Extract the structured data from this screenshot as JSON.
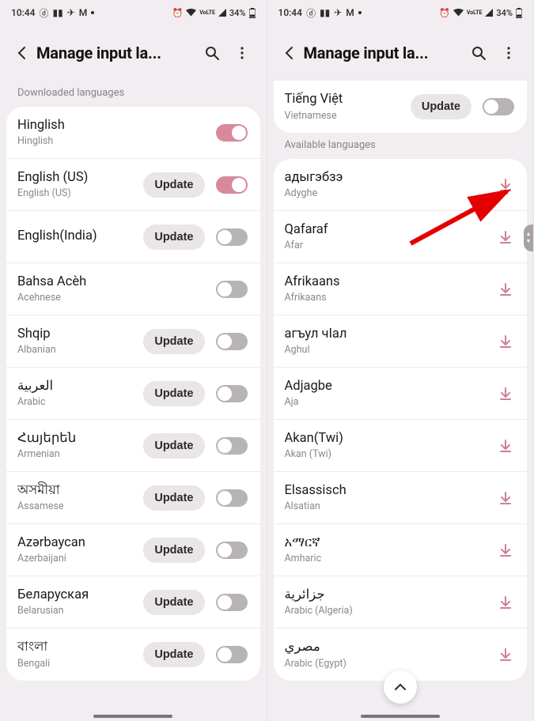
{
  "status": {
    "time": "10:44",
    "battery": "34%",
    "lte": "VoLTE"
  },
  "header": {
    "title": "Manage input la..."
  },
  "left": {
    "section_label": "Downloaded languages",
    "update_label": "Update",
    "rows": [
      {
        "title": "Hinglish",
        "sub": "Hinglish",
        "update": false,
        "toggle": "on"
      },
      {
        "title": "English (US)",
        "sub": "English (US)",
        "update": true,
        "toggle": "on"
      },
      {
        "title": "English(India)",
        "sub": "",
        "update": true,
        "toggle": "off"
      },
      {
        "title": "Bahsa Acèh",
        "sub": "Acehnese",
        "update": false,
        "toggle": "off"
      },
      {
        "title": "Shqip",
        "sub": "Albanian",
        "update": true,
        "toggle": "off"
      },
      {
        "title": "العربية",
        "sub": "Arabic",
        "update": true,
        "toggle": "off"
      },
      {
        "title": "Հայերեն",
        "sub": "Armenian",
        "update": true,
        "toggle": "off"
      },
      {
        "title": "অসমীয়া",
        "sub": "Assamese",
        "update": true,
        "toggle": "off"
      },
      {
        "title": "Azərbaycan",
        "sub": "Azerbaijani",
        "update": true,
        "toggle": "off"
      },
      {
        "title": "Беларуская",
        "sub": "Belarusian",
        "update": true,
        "toggle": "off"
      },
      {
        "title": "বাংলা",
        "sub": "Bengali",
        "update": true,
        "toggle": "off"
      }
    ]
  },
  "right": {
    "top": {
      "title": "Tiếng Việt",
      "sub": "Vietnamese",
      "update_label": "Update"
    },
    "section_label": "Available languages",
    "rows": [
      {
        "title": "адыгэбзэ",
        "sub": "Adyghe"
      },
      {
        "title": "Qafaraf",
        "sub": "Afar"
      },
      {
        "title": "Afrikaans",
        "sub": "Afrikaans"
      },
      {
        "title": "агъул чӏал",
        "sub": "Aghul"
      },
      {
        "title": "Adjagbe",
        "sub": "Aja"
      },
      {
        "title": "Akan(Twi)",
        "sub": "Akan (Twi)"
      },
      {
        "title": "Elsassisch",
        "sub": "Alsatian"
      },
      {
        "title": "አማርኛ",
        "sub": "Amharic"
      },
      {
        "title": "جزائرية",
        "sub": "Arabic (Algeria)"
      },
      {
        "title": "مصري",
        "sub": "Arabic (Egypt)"
      }
    ]
  }
}
